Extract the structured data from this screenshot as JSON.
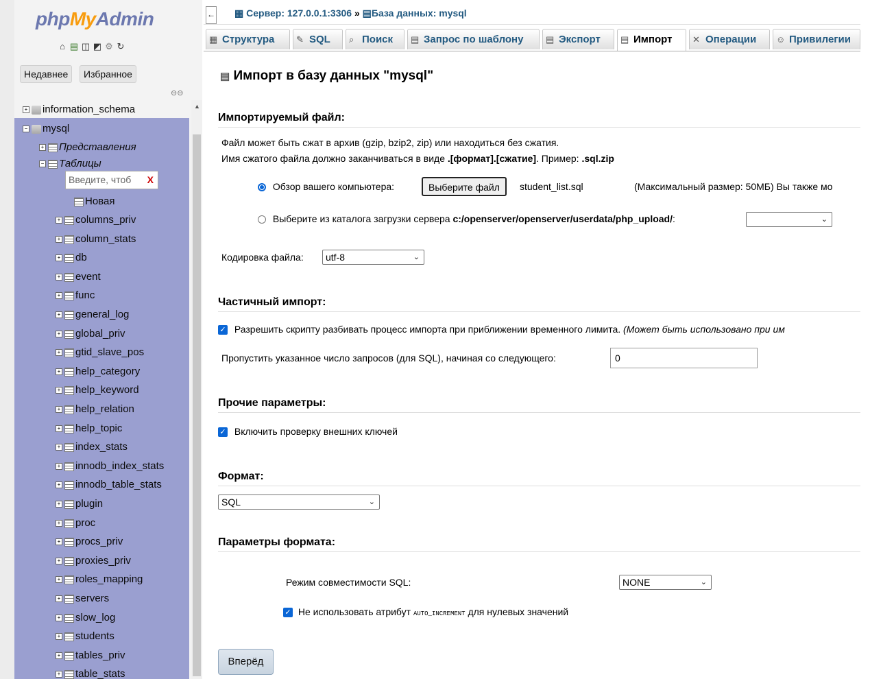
{
  "app": {
    "logo_php": "php",
    "logo_my": "My",
    "logo_admin": "Admin"
  },
  "nav": {
    "recent_tab": "Недавнее",
    "favorites_tab": "Избранное",
    "toolbar_icons": [
      "home-icon",
      "sql-icon",
      "docs-icon",
      "settings-icon",
      "tools-icon",
      "reload-icon"
    ],
    "databases": {
      "information_schema": "information_schema",
      "mysql": "mysql"
    },
    "views_label": "Представления",
    "tables_label": "Таблицы",
    "filter_placeholder": "Введите, чтоб",
    "filter_clear": "X",
    "new_table": "Новая",
    "tables": [
      "columns_priv",
      "column_stats",
      "db",
      "event",
      "func",
      "general_log",
      "global_priv",
      "gtid_slave_pos",
      "help_category",
      "help_keyword",
      "help_relation",
      "help_topic",
      "index_stats",
      "innodb_index_stats",
      "innodb_table_stats",
      "plugin",
      "proc",
      "procs_priv",
      "proxies_priv",
      "roles_mapping",
      "servers",
      "slow_log",
      "students",
      "tables_priv",
      "table_stats"
    ]
  },
  "breadcrumb": {
    "server": "Сервер: 127.0.0.1:3306",
    "separator": "»",
    "database": "База данных: mysql"
  },
  "tabs": [
    {
      "label": "Структура"
    },
    {
      "label": "SQL"
    },
    {
      "label": "Поиск"
    },
    {
      "label": "Запрос по шаблону"
    },
    {
      "label": "Экспорт"
    },
    {
      "label": "Импорт"
    },
    {
      "label": "Операции"
    },
    {
      "label": "Привилегии"
    }
  ],
  "main": {
    "heading": "Импорт в базу данных \"mysql\"",
    "file_section": {
      "title": "Импортируемый файл:",
      "desc1": "Файл может быть сжат в архив (gzip, bzip2, zip) или находиться без сжатия.",
      "desc2_pre": "Имя сжатого файла должно заканчиваться в виде ",
      "desc2_bold": ".[формат].[сжатие]",
      "desc2_mid": ". Пример: ",
      "desc2_example": ".sql.zip",
      "browse_label": "Обзор вашего компьютера:",
      "choose_button": "Выберите файл",
      "chosen_file": "student_list.sql",
      "max_size": "(Максимальный размер: 50МБ) Вы также мо",
      "server_dir_label": "Выберите из каталога загрузки сервера ",
      "server_dir_path": "c:/openserver/openserver/userdata/php_upload/",
      "server_dir_colon": ":",
      "server_dir_value": "",
      "encoding_label": "Кодировка файла:",
      "encoding_value": "utf-8"
    },
    "partial_section": {
      "title": "Частичный импорт:",
      "allow_interrupt": "Разрешить скрипту разбивать процесс импорта при приближении временного лимита. ",
      "allow_interrupt_note": "(Может быть использовано при им",
      "skip_label": "Пропустить указанное число запросов (для SQL), начиная со следующего:",
      "skip_value": "0"
    },
    "other_section": {
      "title": "Прочие параметры:",
      "fk_checks": "Включить проверку внешних ключей"
    },
    "format_section": {
      "title": "Формат:",
      "format_value": "SQL"
    },
    "format_options_section": {
      "title": "Параметры формата:",
      "compat_label": "Режим совместимости SQL:",
      "compat_value": "NONE",
      "no_auto_pre": "Не использовать атрибут ",
      "no_auto_code": "AUTO_INCREMENT",
      "no_auto_post": " для нулевых значений"
    },
    "go_button": "Вперёд"
  },
  "colors": {
    "nav_highlight": "#9a9fd0",
    "link": "#235a81",
    "checkbox": "#0a66d6",
    "logo_accent": "#f89c0e"
  }
}
